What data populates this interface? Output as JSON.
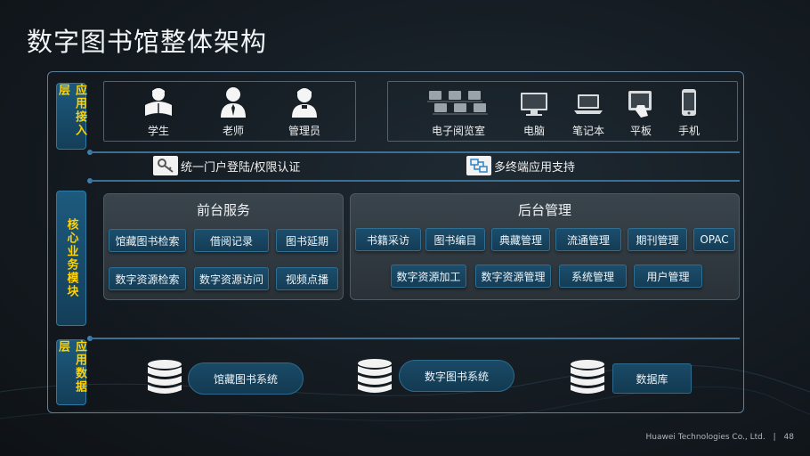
{
  "title": "数字图书馆整体架构",
  "layers": {
    "access": "应用接入层",
    "core": "核心业务模块",
    "data": "应用数据层"
  },
  "users": [
    "学生",
    "老师",
    "管理员"
  ],
  "devices": [
    "电子阅览室",
    "电脑",
    "笔记本",
    "平板",
    "手机"
  ],
  "support": {
    "portal": "统一门户登陆/权限认证",
    "multi_terminal": "多终端应用支持"
  },
  "frontend": {
    "title": "前台服务",
    "row1": [
      "馆藏图书检索",
      "借阅记录",
      "图书延期"
    ],
    "row2": [
      "数字资源检索",
      "数字资源访问",
      "视频点播"
    ]
  },
  "backend": {
    "title": "后台管理",
    "row1": [
      "书籍采访",
      "图书编目",
      "典藏管理",
      "流通管理",
      "期刊管理",
      "OPAC"
    ],
    "row2": [
      "数字资源加工",
      "数字资源管理",
      "系统管理",
      "用户管理"
    ]
  },
  "data_layer": [
    "馆藏图书系统",
    "数字图书系统",
    "数据库"
  ],
  "footer": {
    "company": "Huawei Technologies Co., Ltd.",
    "page": "48"
  },
  "colors": {
    "tab_text": "#ffd200",
    "button": "#1b4e6d",
    "frame": "#5f7f9a"
  }
}
